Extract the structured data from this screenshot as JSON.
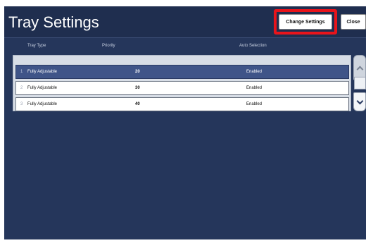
{
  "header": {
    "title": "Tray Settings",
    "change_settings_label": "Change Settings",
    "close_label": "Close"
  },
  "columns": {
    "tray_type": "Tray Type",
    "priority": "Priority",
    "auto_selection": "Auto Selection"
  },
  "rows": [
    {
      "number": "1",
      "tray_type": "Fully Adjustable",
      "priority": "20",
      "auto_selection": "Enabled",
      "selected": true
    },
    {
      "number": "2",
      "tray_type": "Fully Adjustable",
      "priority": "30",
      "auto_selection": "Enabled",
      "selected": false
    },
    {
      "number": "3",
      "tray_type": "Fully Adjustable",
      "priority": "40",
      "auto_selection": "Enabled",
      "selected": false
    }
  ],
  "scrollbar": {
    "up_icon": "chevron-up-icon",
    "down_icon": "chevron-down-icon"
  },
  "colors": {
    "background": "#25365b",
    "selected_row": "#3f5488",
    "highlight": "#e8141b"
  }
}
